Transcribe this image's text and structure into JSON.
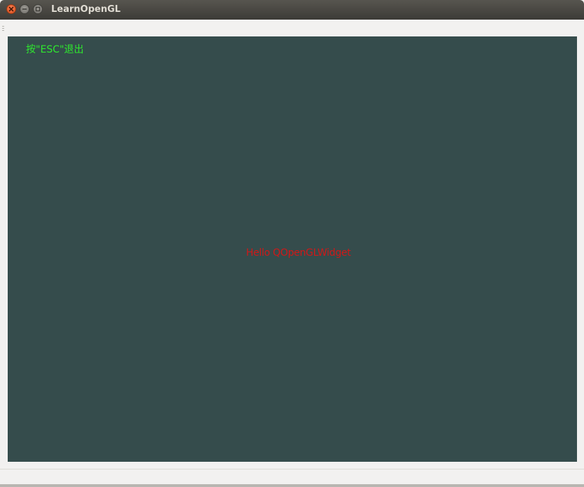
{
  "window": {
    "title": "LearnOpenGL",
    "buttons": {
      "close_icon": "close-icon",
      "minimize_icon": "minimize-icon",
      "maximize_icon": "maximize-icon"
    }
  },
  "gl_view": {
    "background_color": "#354c4c",
    "esc_hint": "按\"ESC\"退出",
    "esc_hint_color": "#2ee82e",
    "hello_text": "Hello QOpenGLWidget",
    "hello_text_color": "#d01818"
  },
  "colors": {
    "titlebar": "#3c3b37",
    "close_button": "#df4a16",
    "window_bg": "#f2f1f0"
  }
}
